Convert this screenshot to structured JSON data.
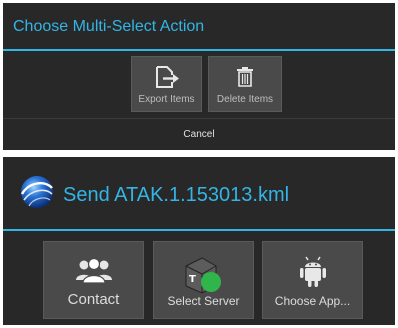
{
  "multi_select_dialog": {
    "title": "Choose Multi-Select Action",
    "export_label": "Export Items",
    "delete_label": "Delete Items",
    "cancel_label": "Cancel"
  },
  "send_dialog": {
    "title": "Send ATAK.1.153013.kml",
    "contact_label": "Contact",
    "server_label": "Select Server",
    "app_label": "Choose App..."
  },
  "colors": {
    "accent": "#33b5e5",
    "panel": "#282828",
    "button": "#4a4a4a",
    "server_status": "#2fb54a"
  },
  "icons": {
    "export": "export-icon",
    "delete": "trash-icon",
    "globe": "globe-icon",
    "contact": "people-icon",
    "server": "server-icon",
    "app": "android-icon"
  }
}
